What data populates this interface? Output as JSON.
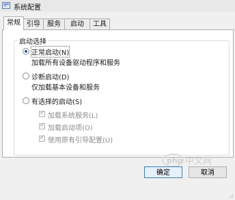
{
  "window": {
    "title": "系统配置"
  },
  "tabs": [
    {
      "label": "常规",
      "active": true
    },
    {
      "label": "引导",
      "active": false
    },
    {
      "label": "服务",
      "active": false
    },
    {
      "label": "启动",
      "active": false
    },
    {
      "label": "工具",
      "active": false
    }
  ],
  "startup_selection": {
    "title": "启动选择",
    "options": [
      {
        "label": "正常启动(N)",
        "description": "加载所有设备驱动程序和服务",
        "selected": true
      },
      {
        "label": "诊断启动(D)",
        "description": "仅加载基本设备和服务",
        "selected": false
      },
      {
        "label": "有选择的启动(S)",
        "selected": false
      }
    ],
    "selective_items": [
      {
        "label": "加载系统服务(L)",
        "checked": true,
        "enabled": false
      },
      {
        "label": "加载启动项(O)",
        "checked": true,
        "enabled": false
      },
      {
        "label": "使用原有引导配置(U)",
        "checked": true,
        "enabled": false
      }
    ]
  },
  "buttons": {
    "ok": "确定",
    "cancel": "取消"
  },
  "watermark": {
    "text": "php 中文网"
  },
  "colors": {
    "accent": "#2d5aa0",
    "default_button_border": "#3c7fb1"
  }
}
